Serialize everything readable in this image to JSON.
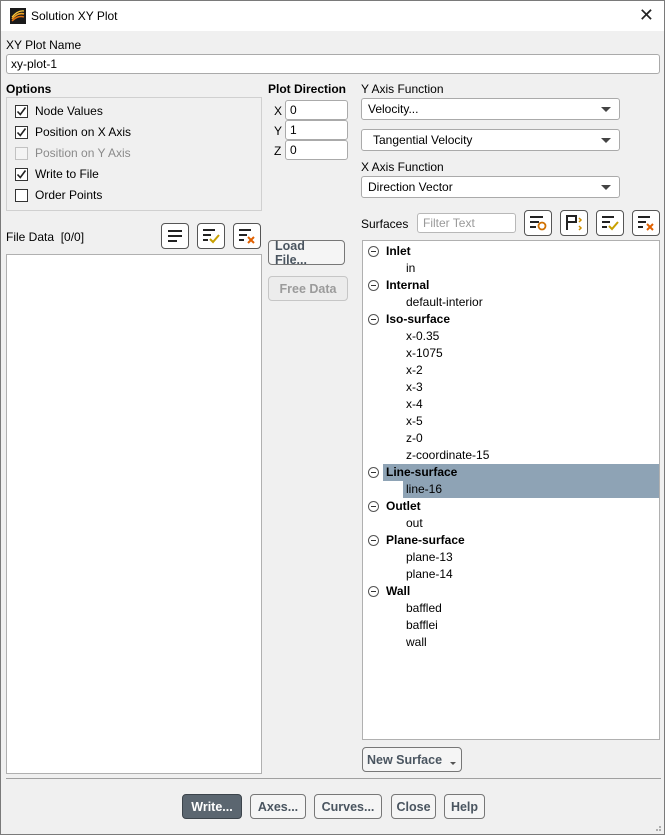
{
  "window": {
    "title": "Solution XY Plot"
  },
  "plot_name": {
    "label": "XY Plot Name",
    "value": "xy-plot-1"
  },
  "options": {
    "label": "Options",
    "items": [
      {
        "label": "Node Values",
        "checked": true,
        "enabled": true
      },
      {
        "label": "Position on X Axis",
        "checked": true,
        "enabled": true
      },
      {
        "label": "Position on Y Axis",
        "checked": false,
        "enabled": false
      },
      {
        "label": "Write to File",
        "checked": true,
        "enabled": true
      },
      {
        "label": "Order Points",
        "checked": false,
        "enabled": true
      }
    ]
  },
  "plot_direction": {
    "label": "Plot Direction",
    "x_label": "X",
    "x": "0",
    "y_label": "Y",
    "y": "1",
    "z_label": "Z",
    "z": "0"
  },
  "y_axis": {
    "label": "Y Axis Function",
    "category": "Velocity...",
    "quantity": "Tangential Velocity"
  },
  "x_axis": {
    "label": "X Axis Function",
    "value": "Direction Vector"
  },
  "file_data": {
    "label": "File Data",
    "count": "[0/0]"
  },
  "buttons": {
    "load_file": "Load File...",
    "free_data": "Free Data",
    "new_surface": "New Surface",
    "write": "Write...",
    "axes": "Axes...",
    "curves": "Curves...",
    "close": "Close",
    "help": "Help"
  },
  "surfaces": {
    "label": "Surfaces",
    "filter_placeholder": "Filter Text",
    "groups": [
      {
        "name": "Inlet",
        "items": [
          "in"
        ]
      },
      {
        "name": "Internal",
        "items": [
          "default-interior"
        ]
      },
      {
        "name": "Iso-surface",
        "items": [
          "x-0.35",
          "x-1075",
          "x-2",
          "x-3",
          "x-4",
          "x-5",
          "z-0",
          "z-coordinate-15"
        ]
      },
      {
        "name": "Line-surface",
        "items": [
          "line-16"
        ],
        "selected": true
      },
      {
        "name": "Outlet",
        "items": [
          "out"
        ]
      },
      {
        "name": "Plane-surface",
        "items": [
          "plane-13",
          "plane-14"
        ]
      },
      {
        "name": "Wall",
        "items": [
          "baffled",
          "bafflei",
          "wall"
        ]
      }
    ]
  }
}
